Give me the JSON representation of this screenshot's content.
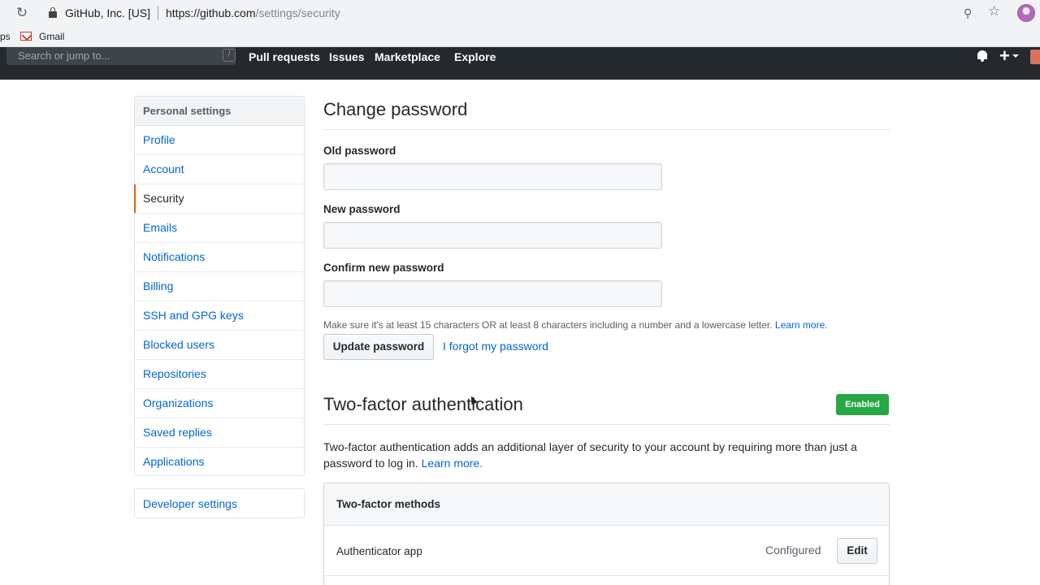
{
  "browser": {
    "site_name": "GitHub, Inc. [US]",
    "url_origin": "https://github.com",
    "url_path": "/settings/security",
    "bookmark_apps": "ps",
    "bookmark_gmail": "Gmail"
  },
  "header": {
    "search_placeholder": "Search or jump to...",
    "search_shortcut": "/",
    "nav": [
      "Pull requests",
      "Issues",
      "Marketplace",
      "Explore"
    ]
  },
  "sidebar": {
    "heading": "Personal settings",
    "items": [
      {
        "label": "Profile"
      },
      {
        "label": "Account"
      },
      {
        "label": "Security",
        "selected": true
      },
      {
        "label": "Emails"
      },
      {
        "label": "Notifications"
      },
      {
        "label": "Billing"
      },
      {
        "label": "SSH and GPG keys"
      },
      {
        "label": "Blocked users"
      },
      {
        "label": "Repositories"
      },
      {
        "label": "Organizations"
      },
      {
        "label": "Saved replies"
      },
      {
        "label": "Applications"
      }
    ],
    "developer_settings": "Developer settings"
  },
  "change_password": {
    "title": "Change password",
    "old_label": "Old password",
    "new_label": "New password",
    "confirm_label": "Confirm new password",
    "note": "Make sure it's at least 15 characters OR at least 8 characters including a number and a lowercase letter.",
    "note_link": "Learn more.",
    "update_button": "Update password",
    "forgot_link": "I forgot my password"
  },
  "two_factor": {
    "title": "Two-factor authentication",
    "badge": "Enabled",
    "description": "Two-factor authentication adds an additional layer of security to your account by requiring more than just a password to log in.",
    "description_link": "Learn more.",
    "methods_heading": "Two-factor methods",
    "methods": [
      {
        "label": "Authenticator app",
        "status": "Configured",
        "action": "Edit"
      }
    ]
  },
  "colors": {
    "header_bg": "#24292e",
    "link": "#0366d6",
    "selected_accent": "#e36209",
    "badge_green": "#28a745"
  }
}
